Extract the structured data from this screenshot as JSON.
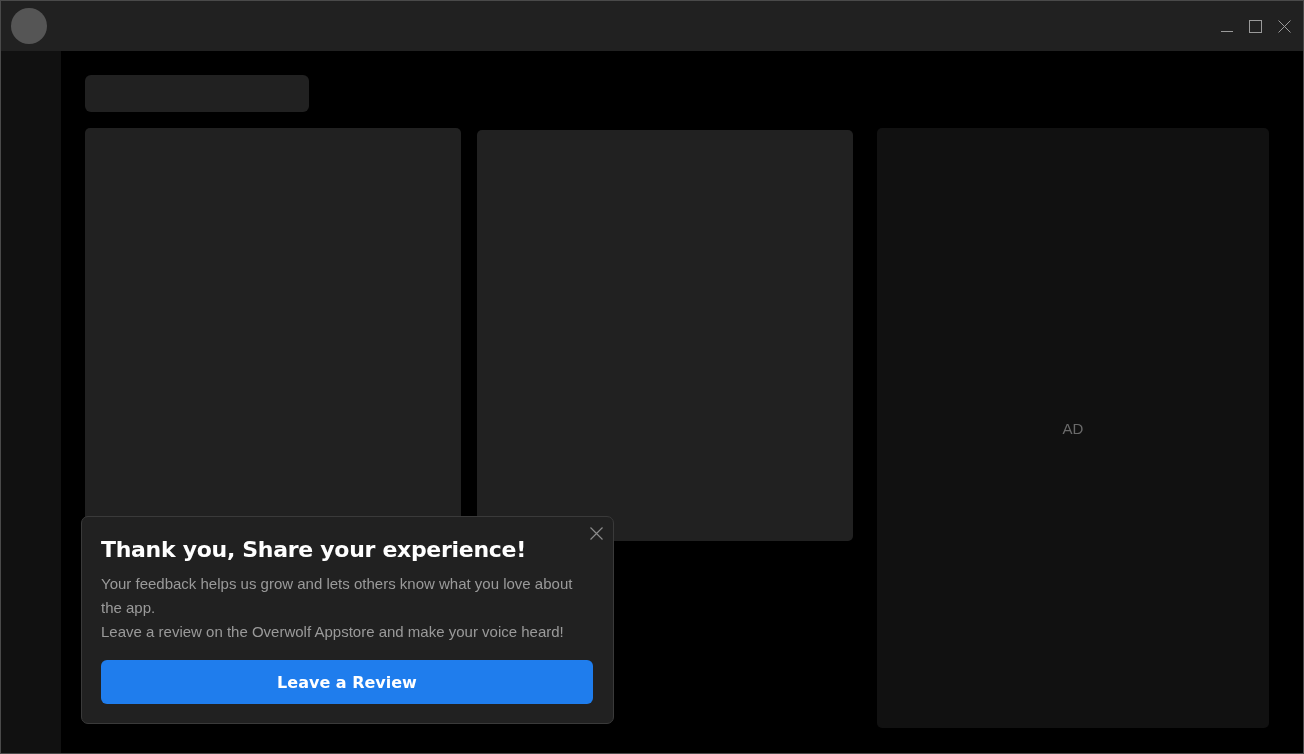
{
  "ad_panel": {
    "label": "AD"
  },
  "review_popup": {
    "title": "Thank you, Share your experience!",
    "body": [
      "Your feedback helps us grow and lets others know what you love about the app.",
      "Leave a review on the Overwolf Appstore and make your voice heard!"
    ],
    "button": "Leave a Review"
  }
}
